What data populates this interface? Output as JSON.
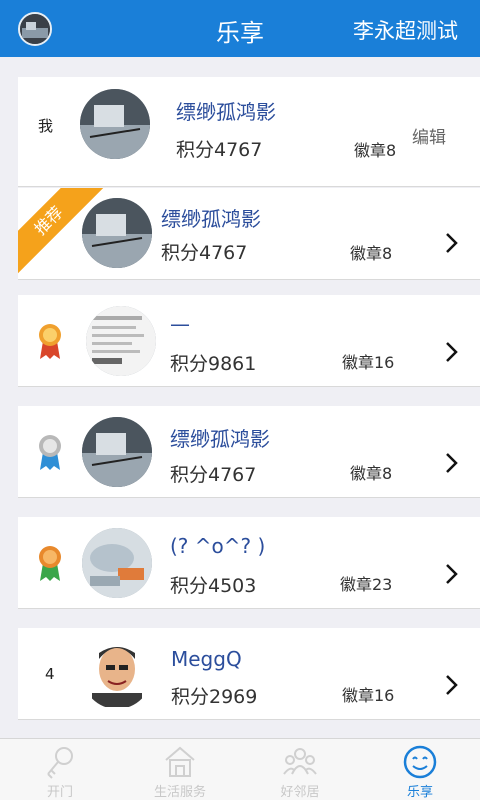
{
  "header": {
    "title": "乐享",
    "right_text": "李永超测试"
  },
  "my_row": {
    "rank": "我",
    "name": "缥缈孤鸿影",
    "points": "积分4767",
    "badges": "徽章8",
    "edit_label": "编辑"
  },
  "recommended": {
    "ribbon": "推荐",
    "name": "缥缈孤鸿影",
    "points": "积分4767",
    "badges": "徽章8"
  },
  "ranking": [
    {
      "rank": "1",
      "medal": "gold",
      "name": "—",
      "points": "积分9861",
      "badges": "徽章16"
    },
    {
      "rank": "2",
      "medal": "silver",
      "name": "缥缈孤鸿影",
      "points": "积分4767",
      "badges": "徽章8"
    },
    {
      "rank": "3",
      "medal": "bronze",
      "name": "(?  ^o^?  )",
      "points": "积分4503",
      "badges": "徽章23"
    },
    {
      "rank": "4",
      "medal": "",
      "name": "MeggQ",
      "points": "积分2969",
      "badges": "徽章16"
    }
  ],
  "tabbar": {
    "tabs": [
      {
        "label": "开门",
        "icon": "key-icon"
      },
      {
        "label": "生活服务",
        "icon": "house-icon"
      },
      {
        "label": "好邻居",
        "icon": "people-icon"
      },
      {
        "label": "乐享",
        "icon": "smile-icon"
      }
    ],
    "active_index": 3
  },
  "colors": {
    "primary": "#1a7fd8",
    "ribbon": "#f5a21b",
    "name": "#2c4e9c",
    "gold_medal": "#e07b20",
    "silver_medal": "#b8b8b8",
    "bronze_medal": "#e8892c"
  }
}
